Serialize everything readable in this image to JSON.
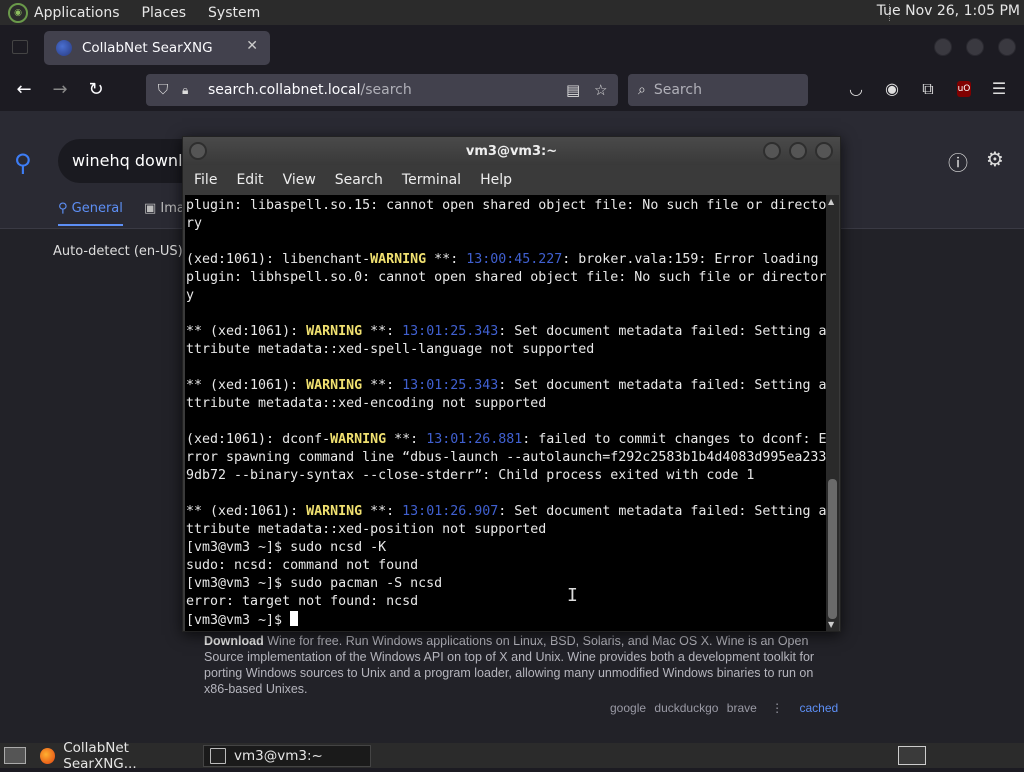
{
  "top_panel": {
    "menus": [
      "Applications",
      "Places",
      "System"
    ],
    "clock": "Tue Nov 26,  1:05 PM"
  },
  "browser": {
    "tab_title": "CollabNet SearXNG",
    "url_host": "search.collabnet.local",
    "url_path": "/search",
    "search_placeholder": "Search"
  },
  "searx": {
    "query": "winehq downloa",
    "tab_general": "General",
    "tab_images": "Ima",
    "autodetect": "Auto-detect (en-US)",
    "result_bold": "Download",
    "result_text": " Wine for free. Run Windows applications on Linux, BSD, Solaris, and Mac OS X. Wine is an Open Source implementation of the Windows API on top of X and Unix. Wine provides both a development toolkit for porting Windows sources to Unix and a program loader, allowing many unmodified Windows binaries to run on x86-based Unixes.",
    "engines": [
      "google",
      "duckduckgo",
      "brave"
    ],
    "cached": "cached"
  },
  "terminal": {
    "title": "vm3@vm3:~",
    "menu": [
      "File",
      "Edit",
      "View",
      "Search",
      "Terminal",
      "Help"
    ],
    "lines": [
      {
        "a": "plugin: libaspell.so.15: cannot open shared object file: No such file or directo"
      },
      {
        "a": "ry"
      },
      {
        "a": ""
      },
      {
        "a": "(xed:1061): libenchant-",
        "w": "WARNING",
        "b": " **: ",
        "t": "13:00:45.227",
        "c": ": broker.vala:159: Error loading"
      },
      {
        "a": "plugin: libhspell.so.0: cannot open shared object file: No such file or director"
      },
      {
        "a": "y"
      },
      {
        "a": ""
      },
      {
        "a": "** (xed:1061): ",
        "w": "WARNING",
        "b": " **: ",
        "t": "13:01:25.343",
        "c": ": Set document metadata failed: Setting a"
      },
      {
        "a": "ttribute metadata::xed-spell-language not supported"
      },
      {
        "a": ""
      },
      {
        "a": "** (xed:1061): ",
        "w": "WARNING",
        "b": " **: ",
        "t": "13:01:25.343",
        "c": ": Set document metadata failed: Setting a"
      },
      {
        "a": "ttribute metadata::xed-encoding not supported"
      },
      {
        "a": ""
      },
      {
        "a": "(xed:1061): dconf-",
        "w": "WARNING",
        "b": " **: ",
        "t": "13:01:26.881",
        "c": ": failed to commit changes to dconf: E"
      },
      {
        "a": "rror spawning command line “dbus-launch --autolaunch=f292c2583b1b4d4083d995ea233"
      },
      {
        "a": "9db72 --binary-syntax --close-stderr”: Child process exited with code 1"
      },
      {
        "a": ""
      },
      {
        "a": "** (xed:1061): ",
        "w": "WARNING",
        "b": " **: ",
        "t": "13:01:26.907",
        "c": ": Set document metadata failed: Setting a"
      },
      {
        "a": "ttribute metadata::xed-position not supported"
      },
      {
        "a": "[vm3@vm3 ~]$ sudo ncsd -K"
      },
      {
        "a": "sudo: ncsd: command not found"
      },
      {
        "a": "[vm3@vm3 ~]$ sudo pacman -S ncsd"
      },
      {
        "a": "error: target not found: ncsd"
      },
      {
        "a": "[vm3@vm3 ~]$ "
      }
    ]
  },
  "taskbar": {
    "items": [
      "CollabNet SearXNG...",
      "vm3@vm3:~"
    ]
  },
  "colors": {
    "warning": "#f0e070",
    "timestamp": "#4060d0",
    "accent": "#5d8ff5"
  }
}
